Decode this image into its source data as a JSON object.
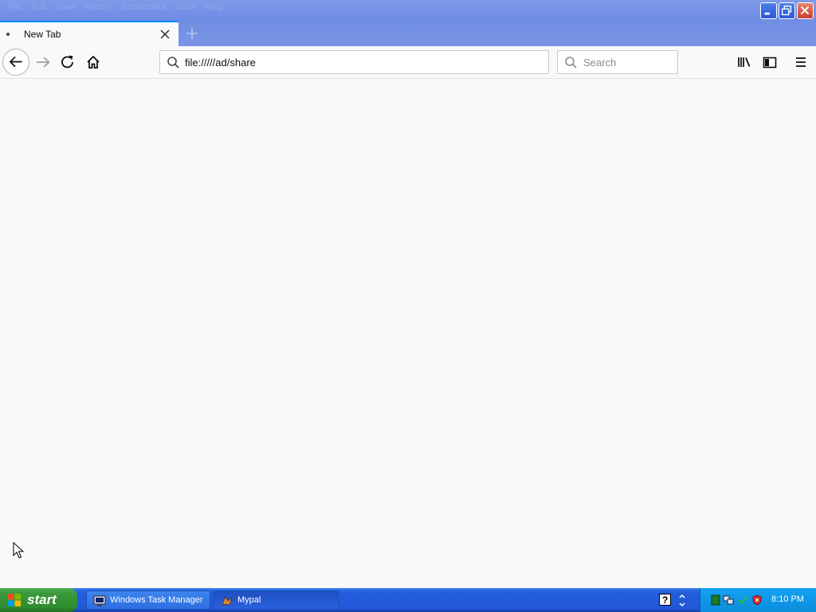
{
  "menu": [
    "File",
    "Edit",
    "View",
    "History",
    "Bookmarks",
    "Tools",
    "Help"
  ],
  "tab": {
    "label": "New Tab"
  },
  "urlbar": {
    "value": "file://///ad/share"
  },
  "searchbar": {
    "placeholder": "Search"
  },
  "taskbar": {
    "start_label": "start",
    "tasks": [
      {
        "label": "Windows Task Manager",
        "icon": "task-manager-icon"
      },
      {
        "label": "Mypal",
        "icon": "mypal-icon"
      }
    ],
    "clock": "8:10 PM"
  },
  "colors": {
    "title_bar": "#7f9ae8",
    "tab_accent": "#0a84ff",
    "taskbar": "#245edc",
    "start": "#3c9a3c",
    "tray": "#0c8ddc"
  }
}
